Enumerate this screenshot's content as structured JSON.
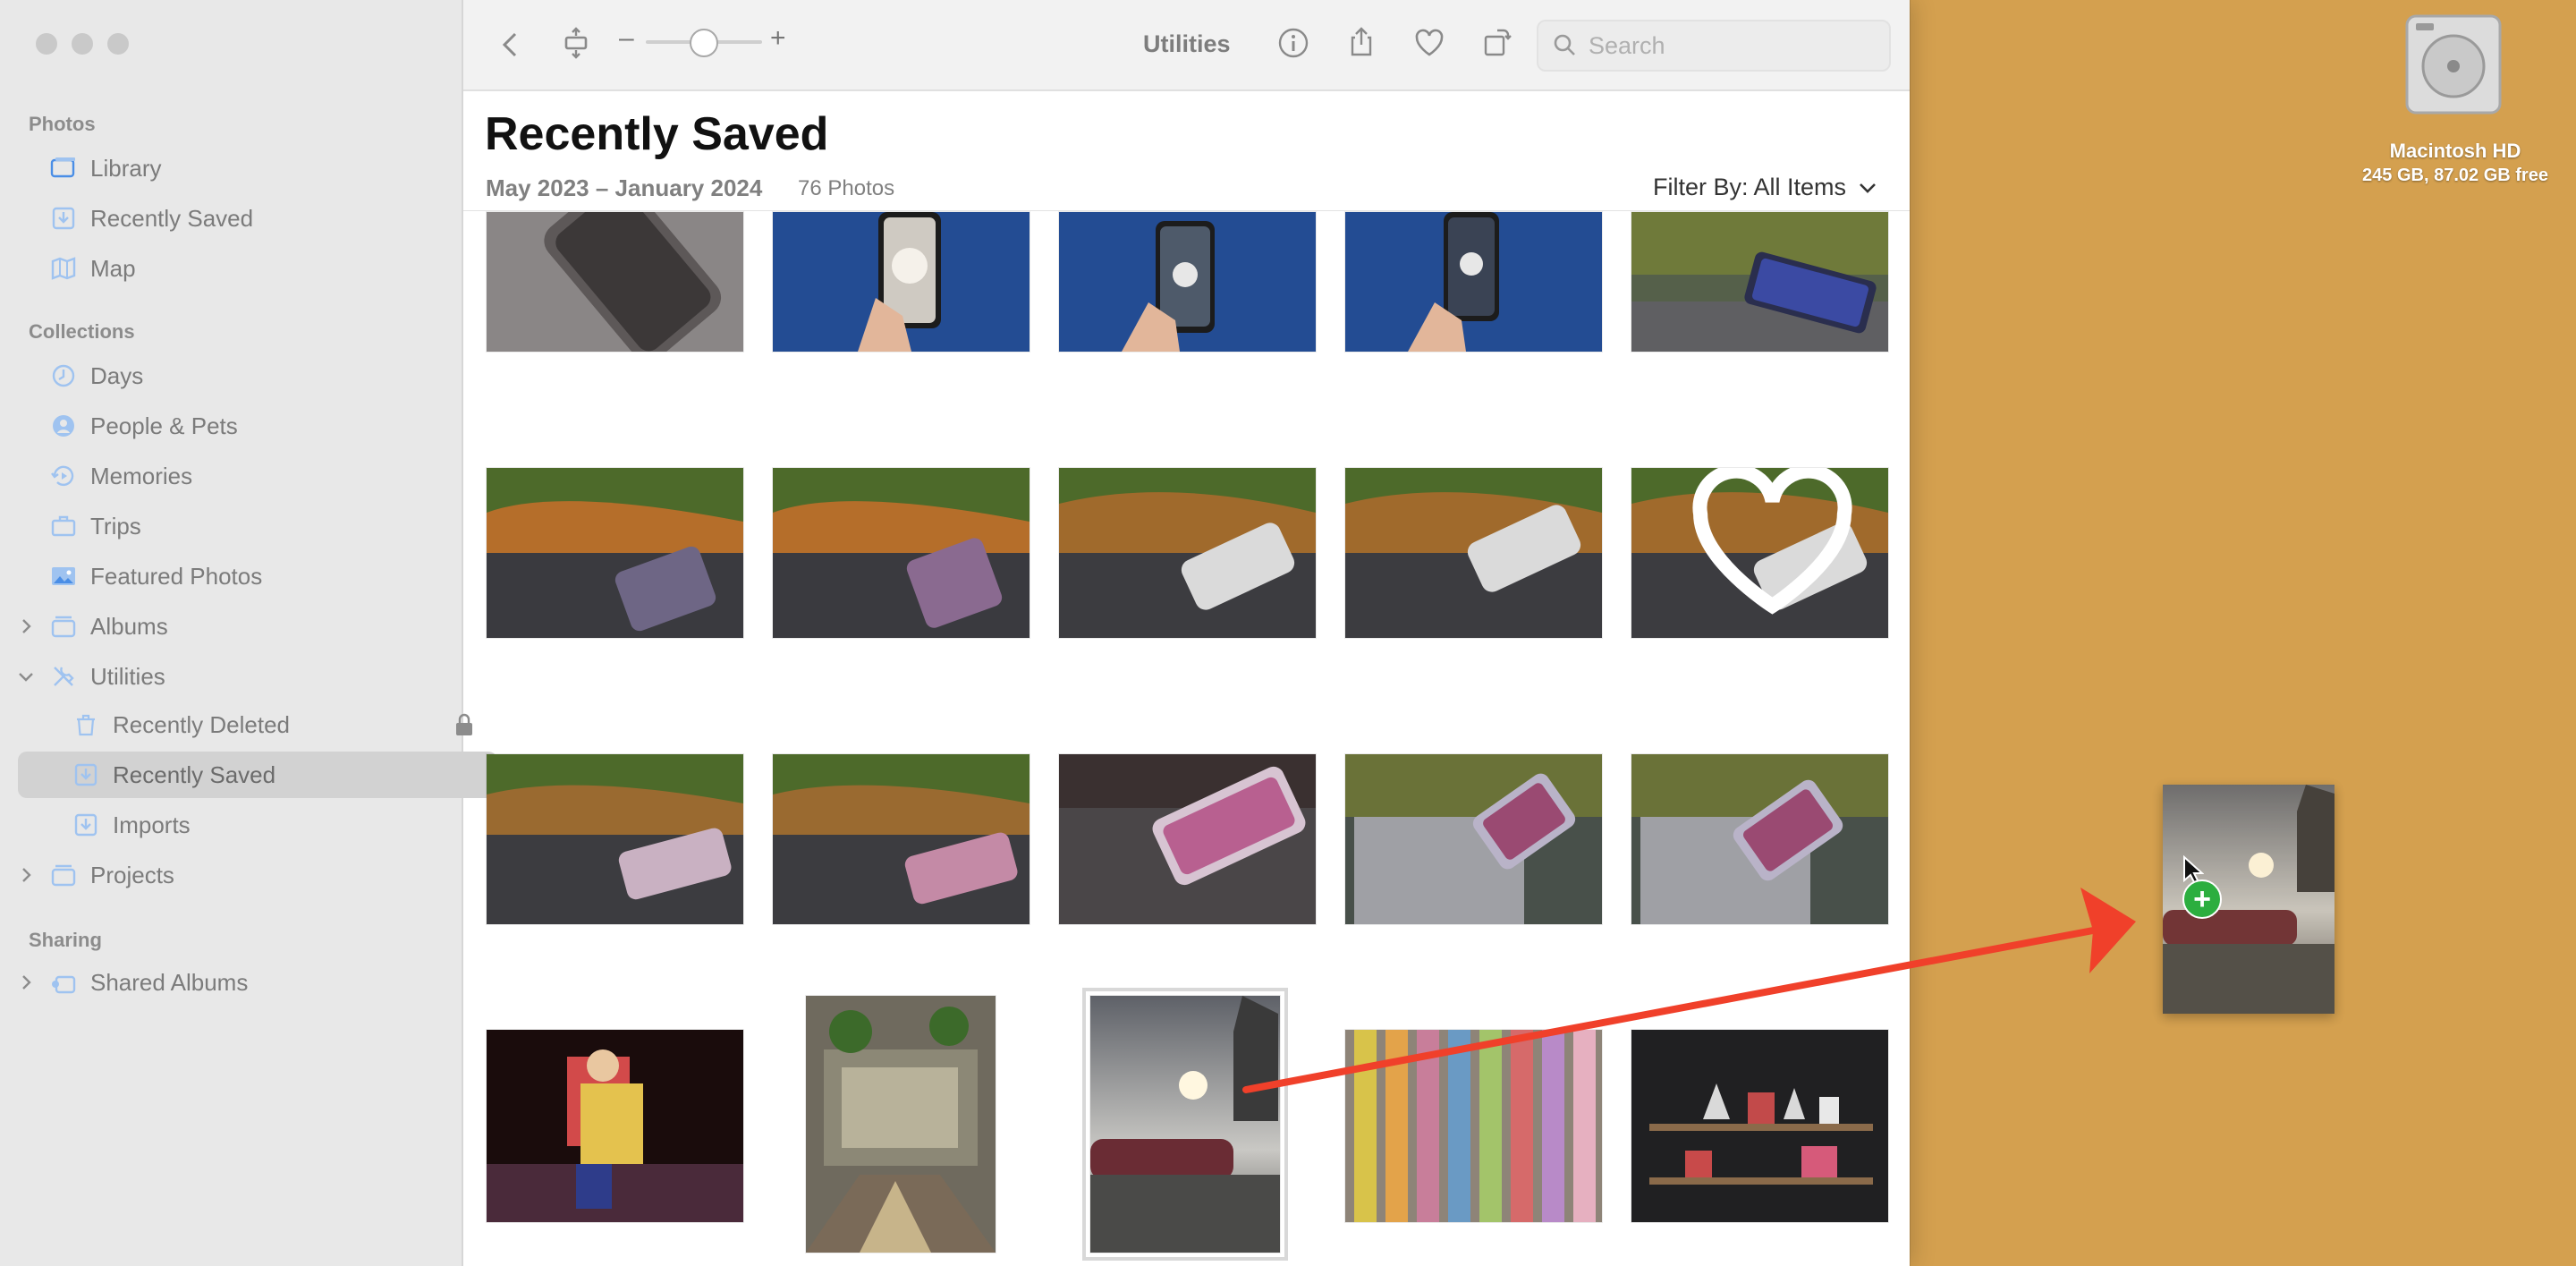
{
  "sidebar": {
    "sections": [
      {
        "title": "Photos",
        "items": [
          {
            "label": "Library",
            "icon": "library-icon"
          },
          {
            "label": "Recently Saved",
            "icon": "download-tray-icon"
          },
          {
            "label": "Map",
            "icon": "map-icon"
          }
        ]
      },
      {
        "title": "Collections",
        "items": [
          {
            "label": "Days",
            "icon": "clock-icon"
          },
          {
            "label": "People & Pets",
            "icon": "person-circle-icon"
          },
          {
            "label": "Memories",
            "icon": "memories-icon"
          },
          {
            "label": "Trips",
            "icon": "suitcase-icon"
          },
          {
            "label": "Featured Photos",
            "icon": "photo-icon"
          },
          {
            "label": "Albums",
            "icon": "album-stack-icon"
          },
          {
            "label": "Utilities",
            "icon": "tools-icon"
          },
          {
            "label": "Recently Deleted",
            "icon": "trash-icon"
          },
          {
            "label": "Recently Saved",
            "icon": "download-tray-icon"
          },
          {
            "label": "Imports",
            "icon": "download-tray-icon"
          },
          {
            "label": "Projects",
            "icon": "folder-stack-icon"
          }
        ]
      },
      {
        "title": "Sharing",
        "items": [
          {
            "label": "Shared Albums",
            "icon": "shared-album-icon"
          }
        ]
      }
    ]
  },
  "toolbar": {
    "title": "Utilities",
    "search_placeholder": "Search",
    "zoom_minus": "–",
    "zoom_plus": "+",
    "zoom_level": 0.5
  },
  "header": {
    "title": "Recently Saved",
    "date_range": "May 2023 – January 2024",
    "photo_count": "76 Photos",
    "filter_label": "Filter By: All Items"
  },
  "desktop": {
    "disk_name": "Macintosh HD",
    "disk_info": "245 GB, 87.02 GB free",
    "drag_badge": "+"
  },
  "colors": {
    "desktop": "#d4a04f",
    "sidebar": "#e8e8e8",
    "accent": "#4a8ee6",
    "drag_arrow": "#f0402a",
    "badge": "#2cae3f"
  }
}
